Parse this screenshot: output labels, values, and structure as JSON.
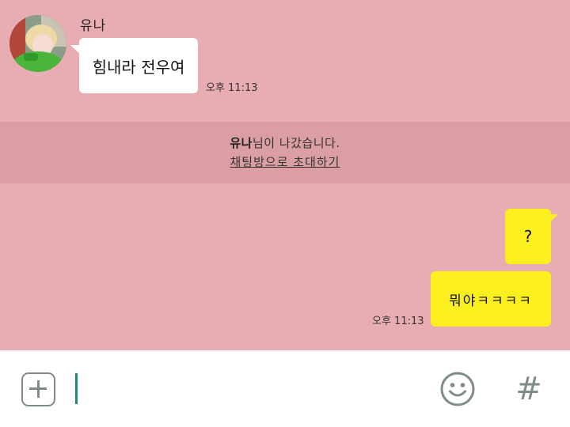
{
  "incoming": {
    "sender_name": "유나",
    "message": "힘내라 전우여",
    "time": "오후 11:13"
  },
  "notice": {
    "name": "유나",
    "left_text": "님이 나갔습니다.",
    "invite_link": "채팅방으로 초대하기"
  },
  "outgoing": {
    "messages": [
      "?",
      "뭐야ㅋㅋㅋㅋ"
    ],
    "time": "오후 11:13"
  },
  "input_bar": {
    "hash_symbol": "#",
    "add_icon": "plus-square-icon",
    "emoji_icon": "smiley-icon"
  },
  "colors": {
    "background": "#e8adb2",
    "notice_band": "#db9ea3",
    "incoming_bubble": "#ffffff",
    "outgoing_bubble": "#fcef1f",
    "cursor": "#1e8b77",
    "icon_gray": "#7f8a8a"
  }
}
